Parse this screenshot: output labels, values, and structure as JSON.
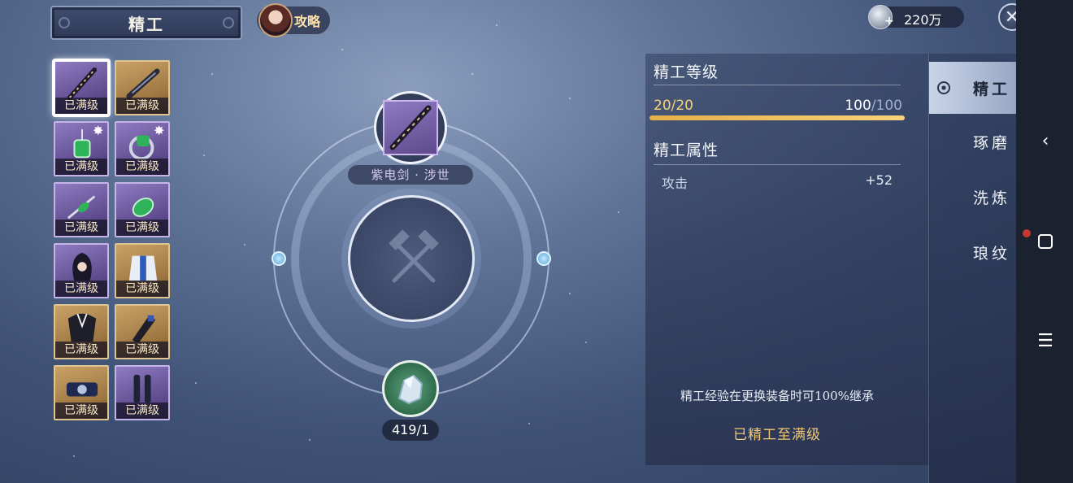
{
  "header": {
    "title": "精工",
    "guide_label": "攻略",
    "currency_value": "220万",
    "currency_plus": "+"
  },
  "inventory": [
    {
      "label": "已满级",
      "rarity": "purple",
      "item": "sword-icon",
      "selected": true
    },
    {
      "label": "已满级",
      "rarity": "gold",
      "item": "gun-icon"
    },
    {
      "label": "已满级",
      "rarity": "purple",
      "item": "jade-pendant-icon",
      "sparkle": true
    },
    {
      "label": "已满级",
      "rarity": "purple",
      "item": "jade-ring-icon",
      "sparkle": true
    },
    {
      "label": "已满级",
      "rarity": "purple",
      "item": "jade-bracelet-icon"
    },
    {
      "label": "已满级",
      "rarity": "purple",
      "item": "jade-amulet-icon"
    },
    {
      "label": "已满级",
      "rarity": "purple",
      "item": "hair-icon"
    },
    {
      "label": "已满级",
      "rarity": "gold",
      "item": "robe-icon"
    },
    {
      "label": "已满级",
      "rarity": "gold",
      "item": "armor-icon"
    },
    {
      "label": "已满级",
      "rarity": "gold",
      "item": "gauntlet-icon"
    },
    {
      "label": "已满级",
      "rarity": "gold",
      "item": "belt-icon"
    },
    {
      "label": "已满级",
      "rarity": "purple",
      "item": "boots-icon"
    }
  ],
  "center": {
    "weapon_name": "紫电剑 · 涉世",
    "material_count": "419/1"
  },
  "panel": {
    "level_title": "精工等级",
    "level_left": "20/20",
    "level_right_current": "100",
    "level_right_sep": "/100",
    "progress": 1.0,
    "attr_title": "精工属性",
    "attr_name": "攻击",
    "attr_value": "+52",
    "note": "精工经验在更换装备时可100%继承",
    "status": "已精工至满级"
  },
  "tabs": [
    {
      "label": "精工",
      "active": true
    },
    {
      "label": "琢磨"
    },
    {
      "label": "洗炼"
    },
    {
      "label": "琅纹"
    }
  ],
  "system_nav": {
    "back": "‹",
    "menu": "☰"
  },
  "colors": {
    "accent_gold": "#f2c873",
    "progress_gold": "#f7d27a",
    "purple_rarity": "#5c4a8c",
    "gold_rarity": "#9c7440"
  }
}
